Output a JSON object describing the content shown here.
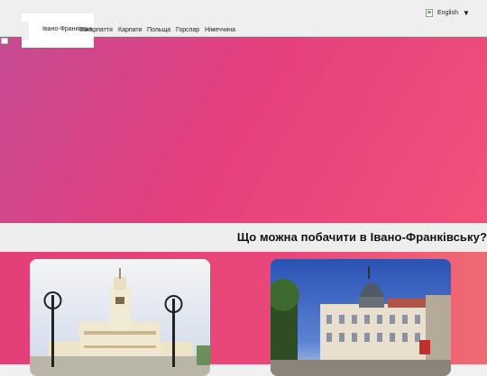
{
  "nav": {
    "items": [
      {
        "label": "Івано-Франківськ"
      },
      {
        "label": "Закарпаття"
      },
      {
        "label": "Карпати"
      },
      {
        "label": "Польща"
      },
      {
        "label": "Горспар"
      },
      {
        "label": "Німеччина"
      }
    ]
  },
  "language": {
    "label": "English",
    "caret": "▼"
  },
  "section": {
    "heading": "Що можна побачити в Івано-Франківську?"
  },
  "colors": {
    "hero_start": "#c64b92",
    "hero_end": "#f0527a",
    "band": "#eeeeee"
  }
}
